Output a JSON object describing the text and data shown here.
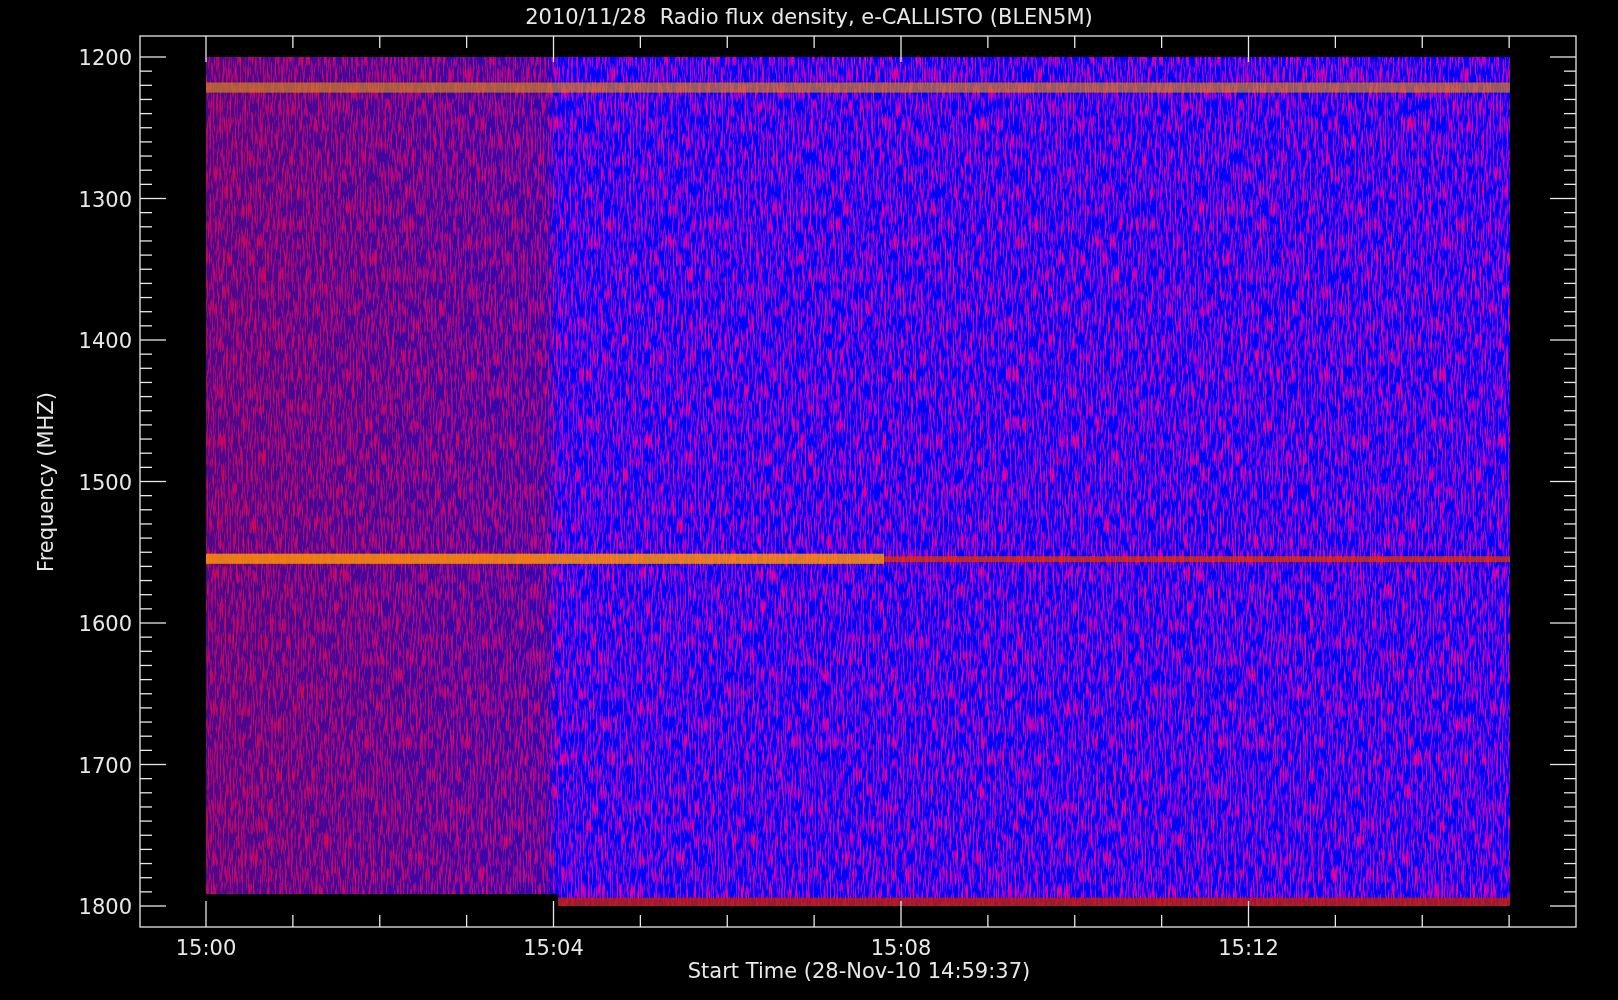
{
  "plot": {
    "title": "2010/11/28  Radio flux density, e-CALLISTO (BLEN5M)",
    "ylabel": "Frequency (MHZ)",
    "xlabel": "Start Time (28-Nov-10 14:59:37)",
    "yticks": [
      "1200",
      "1300",
      "1400",
      "1500",
      "1600",
      "1700",
      "1800"
    ],
    "xticks": [
      "15:00",
      "15:04",
      "15:08",
      "15:12"
    ]
  }
}
